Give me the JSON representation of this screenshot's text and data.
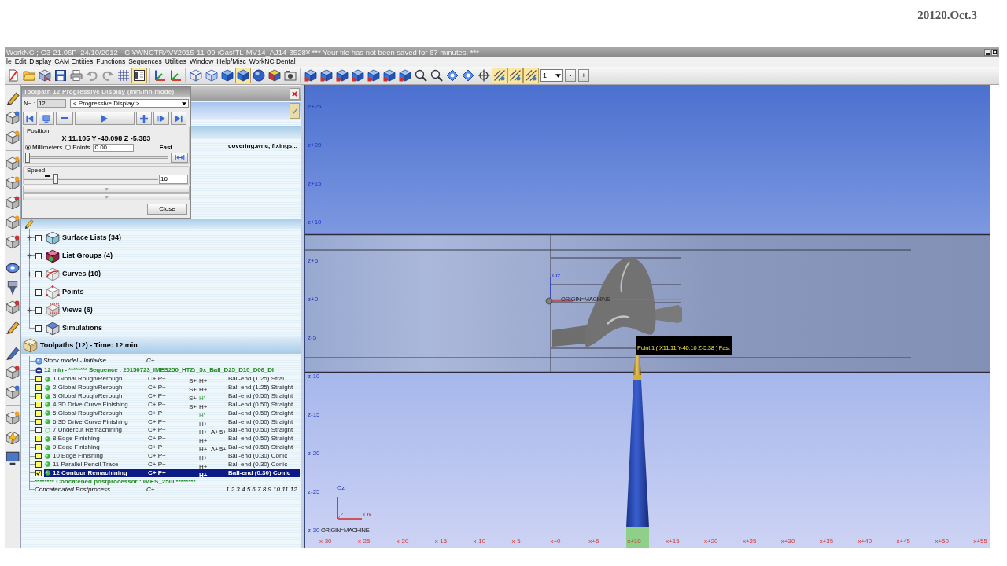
{
  "page_caption": "20120.Oct.3",
  "window": {
    "title": "WorkNC ; G3-21.06F  24/10/2012 - C:¥WNCTRAV¥2015-11-09-iCastTL-MV14_AJ14-3528¥ *** Your file has not been saved for 67 minutes. ***"
  },
  "menu": [
    "le",
    "Edit",
    "Display",
    "CAM Entities",
    "Functions",
    "Sequences",
    "Utilities",
    "Window",
    "Help/Misc",
    "WorkNC Dental"
  ],
  "toolbar": {
    "groups": [
      [
        {
          "kind": "new",
          "pressed": false
        },
        {
          "kind": "open",
          "pressed": false
        },
        {
          "kind": "tools",
          "pressed": false
        },
        {
          "kind": "save",
          "pressed": false
        },
        {
          "kind": "print",
          "pressed": false
        },
        {
          "kind": "undo",
          "pressed": false
        },
        {
          "kind": "redo",
          "pressed": false
        },
        {
          "kind": "grid",
          "pressed": false
        },
        {
          "kind": "panel",
          "pressed": true
        }
      ],
      [
        {
          "kind": "axes",
          "pressed": false
        },
        {
          "kind": "axes",
          "pressed": false
        }
      ],
      [
        {
          "kind": "cube-wire",
          "pressed": false
        },
        {
          "kind": "cube-outline",
          "pressed": false
        },
        {
          "kind": "cube-solid",
          "pressed": false
        },
        {
          "kind": "cube-solid",
          "pressed": true
        },
        {
          "kind": "sphere",
          "pressed": false
        },
        {
          "kind": "color-cube",
          "pressed": false
        },
        {
          "kind": "camera",
          "pressed": false
        }
      ],
      [
        {
          "kind": "view-cube",
          "pressed": false
        },
        {
          "kind": "view-cube",
          "pressed": false
        },
        {
          "kind": "view-cube",
          "pressed": false
        },
        {
          "kind": "view-cube",
          "pressed": false
        },
        {
          "kind": "view-cube",
          "pressed": false
        },
        {
          "kind": "view-cube",
          "pressed": false
        },
        {
          "kind": "view-cube",
          "pressed": false
        },
        {
          "kind": "zoom",
          "pressed": false
        },
        {
          "kind": "zoom",
          "pressed": false
        },
        {
          "kind": "rotate",
          "pressed": false
        },
        {
          "kind": "rotate",
          "pressed": false
        },
        {
          "kind": "target",
          "pressed": false
        },
        {
          "kind": "lines",
          "pressed": true
        },
        {
          "kind": "lines",
          "pressed": true
        },
        {
          "kind": "lines",
          "pressed": true
        }
      ]
    ],
    "layer": "1",
    "steppers": [
      "-",
      "+"
    ]
  },
  "panel": {
    "file_info": "covering.wnc, fixings...",
    "entities": [
      {
        "label": "Surface Lists (34)",
        "kind": "surfaces",
        "expandable": true,
        "checked": false
      },
      {
        "label": "List Groups (4)",
        "kind": "groups",
        "expandable": true,
        "checked": false
      },
      {
        "label": "Curves (10)",
        "kind": "curves",
        "expandable": true,
        "checked": false
      },
      {
        "label": "Points",
        "kind": "points",
        "expandable": false,
        "checked": false
      },
      {
        "label": "Views (6)",
        "kind": "views",
        "expandable": true,
        "checked": false
      },
      {
        "label": "Simulations",
        "kind": "simulations",
        "expandable": false,
        "checked": false
      }
    ],
    "toolpaths": {
      "header": "Toolpaths (12) - Time: 12 min",
      "stock": {
        "name": "Stock model - Initialise",
        "flags": "C+"
      },
      "sequence": {
        "text": "12 min - ******** Sequence : 20150723_IMES250_HTZr_5x_Ball_D25_D10_D06_DI",
        "expanded": true
      },
      "rows": [
        {
          "name": "1 Global Rough/Rerough",
          "cp": "C+ P+",
          "s": "S+",
          "h": "H+",
          "h_partial": false,
          "tool": "Ball-end (1.25) Strai...",
          "enabled": true,
          "checked": false,
          "selected": false
        },
        {
          "name": "2 Global Rough/Rerough",
          "cp": "C+ P+",
          "s": "S+",
          "h": "H+",
          "h_partial": false,
          "tool": "Ball-end (1.25) Straight",
          "enabled": true,
          "checked": false,
          "selected": false
        },
        {
          "name": "3 Global Rough/Rerough",
          "cp": "C+ P+",
          "s": "S+",
          "h": "H'",
          "h_partial": true,
          "tool": "Ball-end (0.50) Straight",
          "enabled": true,
          "checked": false,
          "selected": false
        },
        {
          "name": "4 3D Drive Curve Finishing",
          "cp": "C+ P+",
          "s": "S+",
          "h": "H+",
          "h_partial": false,
          "tool": "Ball-end (0.50) Straight",
          "enabled": true,
          "checked": false,
          "selected": false
        },
        {
          "name": "5 Global Rough/Rerough",
          "cp": "C+ P+",
          "h": "H'",
          "h_partial": true,
          "tool": "Ball-end (0.50) Straight",
          "enabled": true,
          "checked": false,
          "selected": false
        },
        {
          "name": "6 3D Drive Curve Finishing",
          "cp": "C+ P+",
          "h": "H+",
          "h_partial": false,
          "tool": "Ball-end (0.50) Straight",
          "enabled": true,
          "checked": false,
          "selected": false
        },
        {
          "name": "7 Undercut Remachining",
          "cp": "C+ P+",
          "h": "H+",
          "h_partial": false,
          "extra": "A+ 5+",
          "tool": "Ball-end (0.50) Straight",
          "enabled": false,
          "checked": false,
          "selected": false
        },
        {
          "name": "8 Edge Finishing",
          "cp": "C+ P+",
          "h": "H+",
          "h_partial": false,
          "tool": "Ball-end (0.50) Straight",
          "enabled": true,
          "checked": false,
          "selected": false
        },
        {
          "name": "9 Edge Finishing",
          "cp": "C+ P+",
          "h": "H+",
          "h_partial": false,
          "extra": "A+ 5+",
          "tool": "Ball-end (0.50) Straight",
          "enabled": true,
          "checked": false,
          "selected": false
        },
        {
          "name": "10 Edge Finishing",
          "cp": "C+ P+",
          "h": "H+",
          "h_partial": false,
          "tool": "Ball-end (0.30) Conic",
          "enabled": true,
          "checked": false,
          "selected": false
        },
        {
          "name": "11 Parallel Pencil Trace",
          "cp": "C+ P+",
          "h": "H+",
          "h_partial": false,
          "tool": "Ball-end (0.30) Conic",
          "enabled": true,
          "checked": false,
          "selected": false
        },
        {
          "name": "12 Contour Remachining",
          "cp": "C+ P+",
          "h": "H+",
          "h_partial": false,
          "tool": "Ball-end (0.30) Conic",
          "enabled": true,
          "checked": true,
          "selected": true
        }
      ],
      "postprocessor": "******** Concatened postprocessor : IMES_250i ********",
      "postprocess": {
        "name": "Concatenated Postprocess",
        "flags": "C+",
        "order": "1 2 3 4 5 6 7 8 9 10 11 12"
      }
    }
  },
  "dialog": {
    "title": "Toolpath 12 Progressive Display (mm/mn mode)",
    "n_label": "N~ :",
    "n_value": "12",
    "mode": "< Progressive Display >",
    "position_label": "Position",
    "coordinates": "X 11.105 Y -40.098 Z -5.383",
    "units": [
      {
        "label": "Millimeters",
        "selected": true
      },
      {
        "label": "Points",
        "selected": false
      }
    ],
    "points_value": "0.00",
    "motion": "Fast",
    "position": {
      "level": 0
    },
    "speed_label": "Speed",
    "speed": {
      "level": 0.23
    },
    "speed_value": "16",
    "close": "Close"
  },
  "viewport": {
    "z_labels": [
      "z+25",
      "z+20",
      "z+15",
      "z+10",
      "z+5",
      "z+0",
      "z-5",
      "z-10",
      "z-15",
      "z-20",
      "z-25",
      "z-30"
    ],
    "x_labels": [
      "x-30",
      "x-25",
      "x-20",
      "x-15",
      "x-10",
      "x-5",
      "x+0",
      "x+5",
      "x+10",
      "x+15",
      "x+20",
      "x+25",
      "x+30",
      "x+35",
      "x+40",
      "x+45",
      "x+50",
      "x+55"
    ],
    "origin": {
      "axis": "Oz",
      "label": "ORIGIN=MACHINE"
    },
    "tooltip": "Point 1 ( X11.11 Y-40.10 Z-5.38 ) Fast",
    "triad": {
      "z": "Oz",
      "x": "Ox",
      "label": "ORIGIN=MACHINE"
    }
  }
}
